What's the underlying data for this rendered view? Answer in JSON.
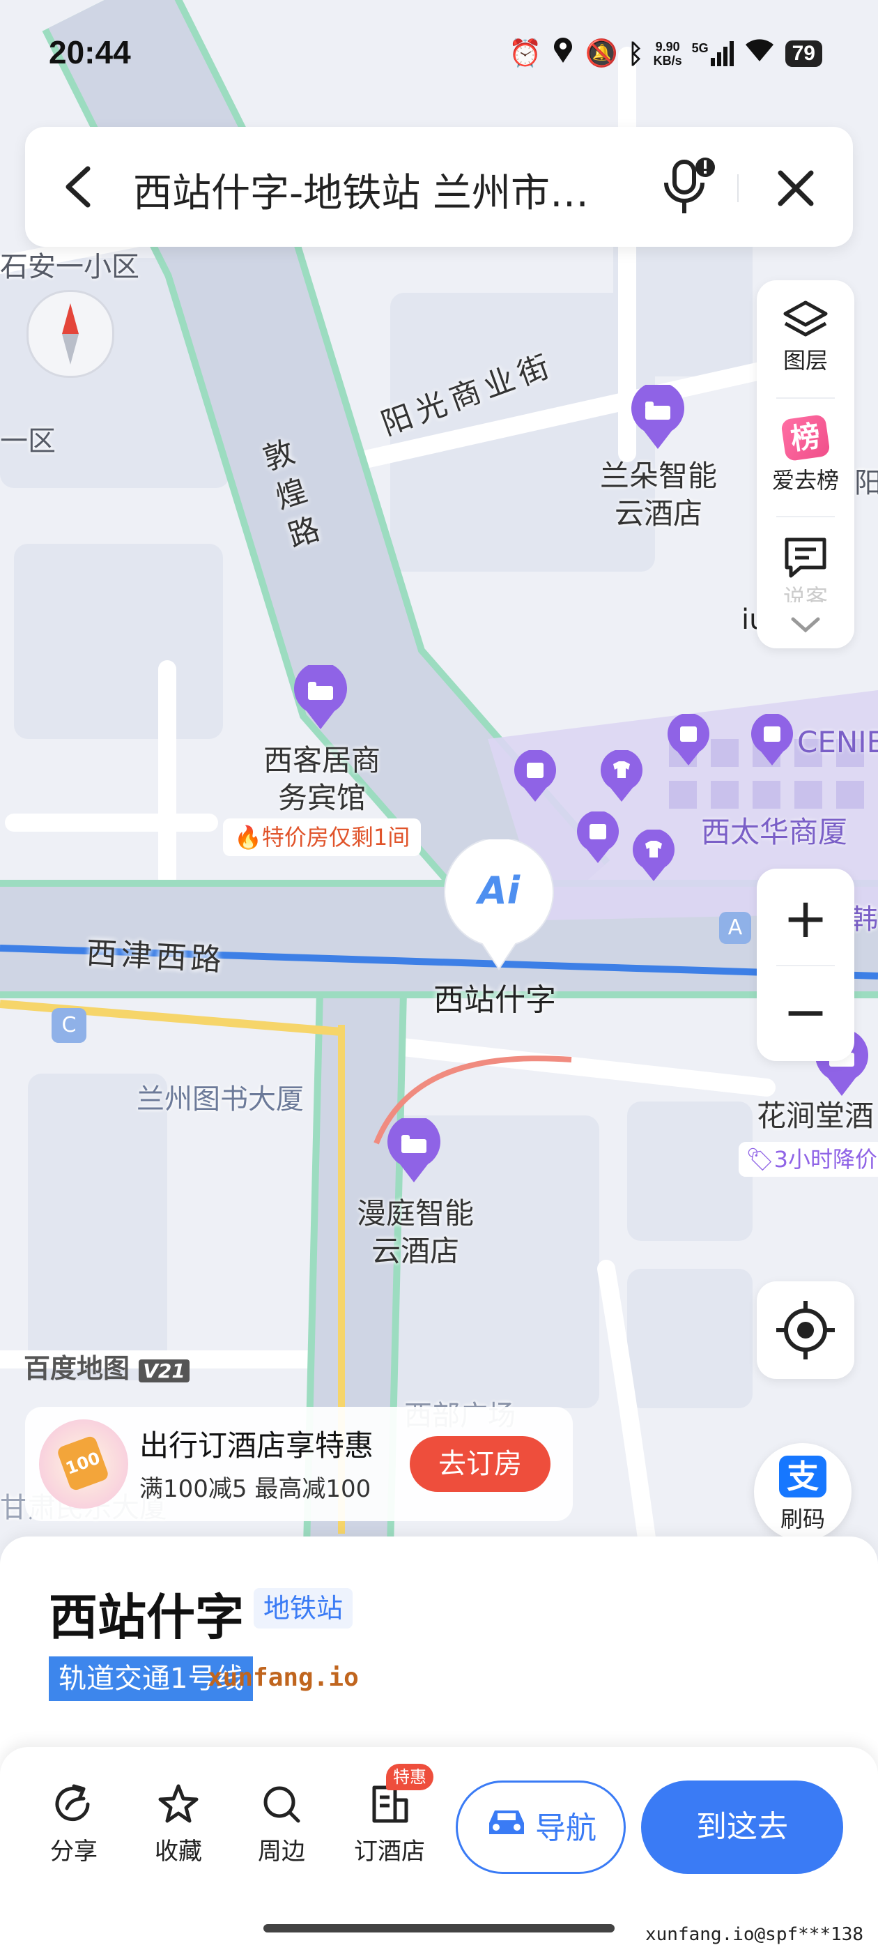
{
  "status_bar": {
    "time": "20:44",
    "speed_value": "9.90",
    "speed_unit": "KB/s",
    "network": "5G",
    "battery": "79"
  },
  "search": {
    "query": "西站什字-地铁站 兰州市…"
  },
  "map": {
    "area_labels": [
      "石安一小区",
      "一区",
      "兰州图书大厦",
      "西部广场",
      "甘肃民乐大厦"
    ],
    "roads": [
      "阳光商业街",
      "敦煌路",
      "西津西路"
    ],
    "pois": [
      {
        "name": "兰朵智能云酒店",
        "lines": [
          "兰朵智能",
          "云酒店"
        ],
        "icon": "hotel-icon"
      },
      {
        "name": "西客居商务宾馆",
        "lines": [
          "西客居商",
          "务宾馆"
        ],
        "icon": "hotel-icon",
        "tag": "特价房仅剩1间"
      },
      {
        "name": "漫庭智能云酒店",
        "lines": [
          "漫庭智能",
          "云酒店"
        ],
        "icon": "hotel-icon"
      },
      {
        "name": "花涧堂酒",
        "icon": "hotel-icon",
        "tag": "3小时降价"
      }
    ],
    "mall": "西太华商厦",
    "mall_brand": "CENIE",
    "selected_marker_label": "西站什字",
    "selected_marker_icon": "Ai",
    "station_exits": [
      "A",
      "C"
    ],
    "partial_labels": [
      "韩",
      "阳",
      "iu"
    ],
    "watermark": "百度地图",
    "version": "V21"
  },
  "controls": {
    "layers": "图层",
    "ranking_badge": "榜",
    "ranking": "爱去榜",
    "comment": "说客",
    "zoom_in": "+",
    "zoom_out": "−",
    "pay_label": "刷码",
    "pay_icon": "支"
  },
  "promo": {
    "badge": "100",
    "title": "出行订酒店享特惠",
    "subtitle": "满100减5 最高减100",
    "button": "去订房"
  },
  "place": {
    "name": "西站什字",
    "type": "地铁站",
    "line": "轨道交通1号线"
  },
  "watermarks": [
    "xunfang.io",
    "xunfang.io@spf***138"
  ],
  "toolbar": {
    "share": "分享",
    "favorite": "收藏",
    "nearby": "周边",
    "hotel": "订酒店",
    "hotel_badge": "特惠",
    "navigate": "导航",
    "go_here": "到这去"
  },
  "colors": {
    "primary_blue": "#3a7bf5",
    "route_blue": "#3d7fe6",
    "poi_purple": "#8f63e6",
    "promo_red": "#ee4e3c",
    "road_green": "#9cdcc0"
  }
}
